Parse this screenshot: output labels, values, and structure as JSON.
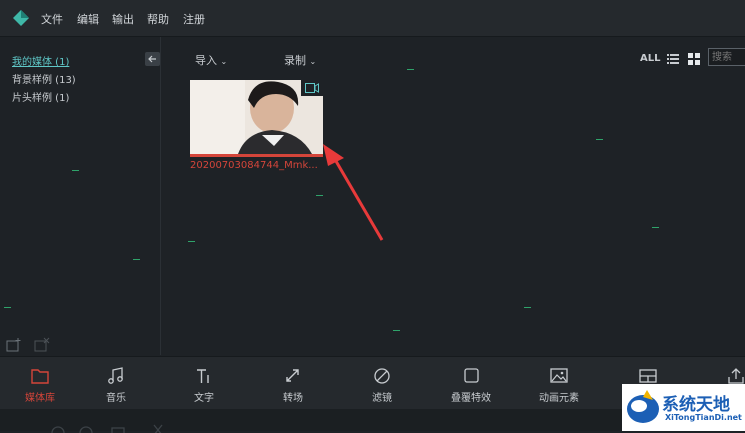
{
  "menu": [
    "文件",
    "编辑",
    "输出",
    "帮助",
    "注册"
  ],
  "library": {
    "items": [
      {
        "label": "我的媒体 (1)",
        "active": true
      },
      {
        "label": "背景样例 (13)",
        "active": false
      },
      {
        "label": "片头样例 (1)",
        "active": false
      }
    ]
  },
  "toolbar": {
    "import_label": "导入",
    "record_label": "录制",
    "view_all": "ALL",
    "search_placeholder": "搜索"
  },
  "media": {
    "filename": "20200703084744_Mmk..."
  },
  "tools": [
    {
      "label": "媒体库",
      "icon": "folder-icon",
      "active": true
    },
    {
      "label": "音乐",
      "icon": "music-icon",
      "active": false
    },
    {
      "label": "文字",
      "icon": "text-icon",
      "active": false
    },
    {
      "label": "转场",
      "icon": "transition-icon",
      "active": false
    },
    {
      "label": "滤镜",
      "icon": "filter-icon",
      "active": false
    },
    {
      "label": "叠覆特效",
      "icon": "overlay-icon",
      "active": false
    },
    {
      "label": "动画元素",
      "icon": "image-icon",
      "active": false
    },
    {
      "label": "",
      "icon": "layout-icon",
      "active": false
    },
    {
      "label": "",
      "icon": "export-icon",
      "active": false
    }
  ],
  "watermark": {
    "main": "系统天地",
    "sub": "XiTongTianDi.net"
  },
  "colors": {
    "accent_red": "#d4453a",
    "accent_teal": "#5fc7c7",
    "background": "#1e2226"
  }
}
